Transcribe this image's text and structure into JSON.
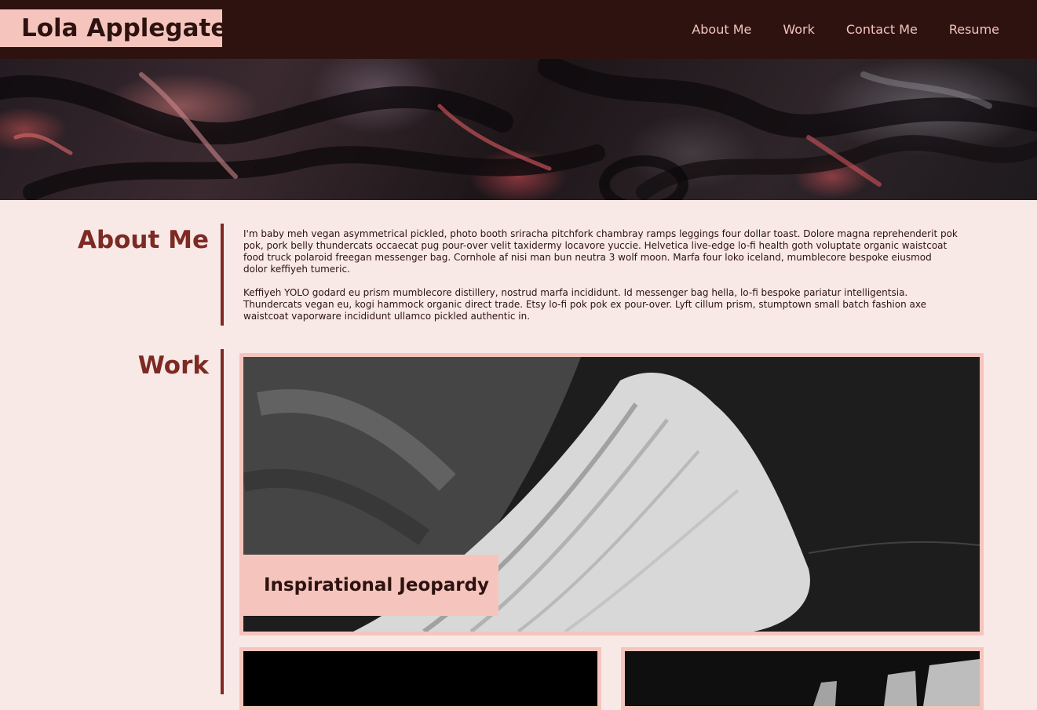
{
  "site": {
    "name": "Lola Applegate"
  },
  "nav": {
    "items": [
      "About Me",
      "Work",
      "Contact Me",
      "Resume"
    ]
  },
  "colors": {
    "header_bg": "#2d1210",
    "accent_pink": "#f5c5bd",
    "accent_red": "#7d2a24",
    "page_bg": "#f8e9e6"
  },
  "about": {
    "title": "About Me",
    "paragraphs": [
      "I'm baby meh vegan asymmetrical pickled, photo booth sriracha pitchfork chambray ramps leggings four dollar toast. Dolore magna reprehenderit pok pok, pork belly thundercats occaecat pug pour-over velit taxidermy locavore yuccie. Helvetica live-edge lo-fi health goth voluptate organic waistcoat food truck polaroid freegan messenger bag. Cornhole af nisi man bun neutra 3 wolf moon. Marfa four loko iceland, mumblecore bespoke eiusmod dolor keffiyeh tumeric.",
      "Keffiyeh YOLO godard eu prism mumblecore distillery, nostrud marfa incididunt. Id messenger bag hella, lo-fi bespoke pariatur intelligentsia. Thundercats vegan eu, kogi hammock organic direct trade. Etsy lo-fi pok pok ex pour-over. Lyft cillum prism, stumptown small batch fashion axe waistcoat vaporware incididunt ullamco pickled authentic in."
    ]
  },
  "work": {
    "title": "Work",
    "projects": [
      {
        "title": "Inspirational Jeopardy"
      }
    ]
  }
}
